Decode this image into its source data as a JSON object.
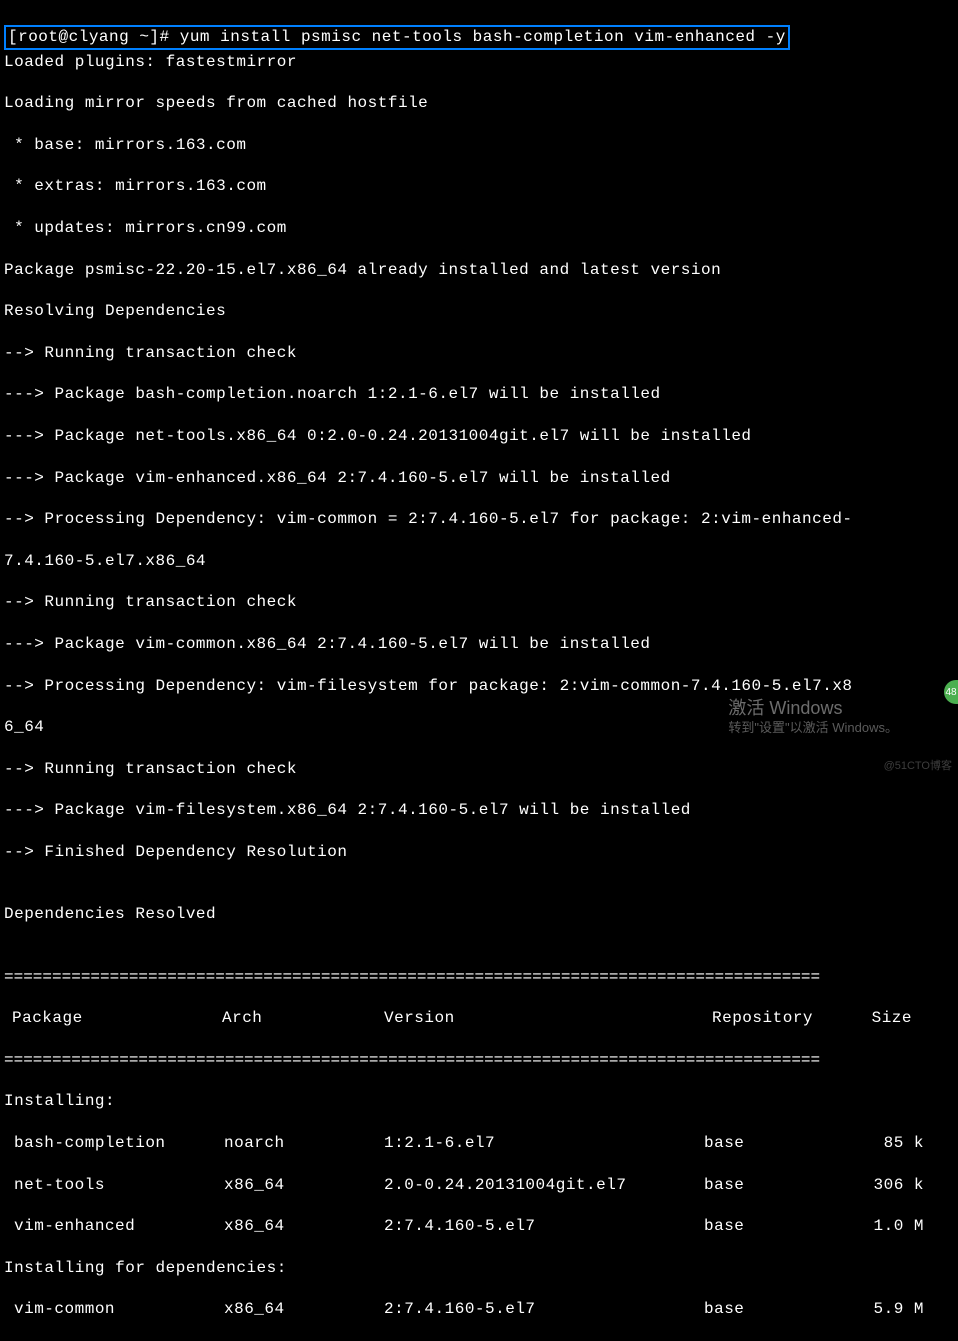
{
  "prompt": {
    "user_host": "[root@clyang ~]#",
    "command": " yum install psmisc net-tools bash-completion vim-enhanced -y"
  },
  "output": {
    "lines": [
      "Loaded plugins: fastestmirror",
      "Loading mirror speeds from cached hostfile",
      " * base: mirrors.163.com",
      " * extras: mirrors.163.com",
      " * updates: mirrors.cn99.com",
      "Package psmisc-22.20-15.el7.x86_64 already installed and latest version",
      "Resolving Dependencies",
      "--> Running transaction check",
      "---> Package bash-completion.noarch 1:2.1-6.el7 will be installed",
      "---> Package net-tools.x86_64 0:2.0-0.24.20131004git.el7 will be installed",
      "---> Package vim-enhanced.x86_64 2:7.4.160-5.el7 will be installed",
      "--> Processing Dependency: vim-common = 2:7.4.160-5.el7 for package: 2:vim-enhanced-",
      "7.4.160-5.el7.x86_64",
      "--> Running transaction check",
      "---> Package vim-common.x86_64 2:7.4.160-5.el7 will be installed",
      "--> Processing Dependency: vim-filesystem for package: 2:vim-common-7.4.160-5.el7.x8",
      "6_64",
      "--> Running transaction check",
      "---> Package vim-filesystem.x86_64 2:7.4.160-5.el7 will be installed",
      "--> Finished Dependency Resolution",
      "",
      "Dependencies Resolved",
      ""
    ]
  },
  "divider": "=====================================================================================",
  "table": {
    "headers": {
      "package": "Package",
      "arch": "Arch",
      "version": "Version",
      "repo": "Repository",
      "size": "Size"
    },
    "installing_label": "Installing:",
    "installing_deps_label": "Installing for dependencies:",
    "rows_installing": [
      {
        "package": "bash-completion",
        "arch": "noarch",
        "version": "1:2.1-6.el7",
        "repo": "base",
        "size": "85 k"
      },
      {
        "package": "net-tools",
        "arch": "x86_64",
        "version": "2.0-0.24.20131004git.el7",
        "repo": "base",
        "size": "306 k"
      },
      {
        "package": "vim-enhanced",
        "arch": "x86_64",
        "version": "2:7.4.160-5.el7",
        "repo": "base",
        "size": "1.0 M"
      }
    ],
    "rows_deps": [
      {
        "package": "vim-common",
        "arch": "x86_64",
        "version": "2:7.4.160-5.el7",
        "repo": "base",
        "size": "5.9 M"
      }
    ]
  },
  "watermark": {
    "title": "激活 Windows",
    "sub": "转到\"设置\"以激活 Windows。"
  },
  "badge": "48",
  "corner": "@51CTO博客"
}
